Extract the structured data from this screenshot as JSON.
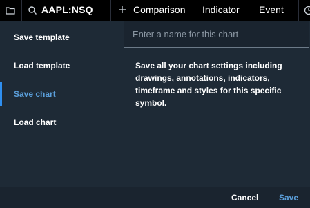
{
  "toolbar": {
    "symbol": "AAPL:NSQ",
    "compare_label": "Comparison",
    "indicator_label": "Indicator",
    "event_label": "Event",
    "icons": {
      "folder": "folder-icon",
      "search": "search-icon",
      "add": "plus-icon",
      "clock": "clock-icon"
    }
  },
  "sidebar": {
    "items": [
      {
        "label": "Save template",
        "active": false
      },
      {
        "label": "Load template",
        "active": false
      },
      {
        "label": "Save chart",
        "active": true
      },
      {
        "label": "Load chart",
        "active": false
      }
    ]
  },
  "panel": {
    "name_placeholder": "Enter a name for this chart",
    "name_value": "",
    "description": "Save all your chart settings including drawings, annotations, indicators, timeframe and styles for this specific symbol."
  },
  "footer": {
    "cancel_label": "Cancel",
    "save_label": "Save"
  },
  "colors": {
    "background": "#1e2a36",
    "toolbar": "#000000",
    "accent": "#5b9fdb",
    "active_bar": "#2f8ff0"
  }
}
